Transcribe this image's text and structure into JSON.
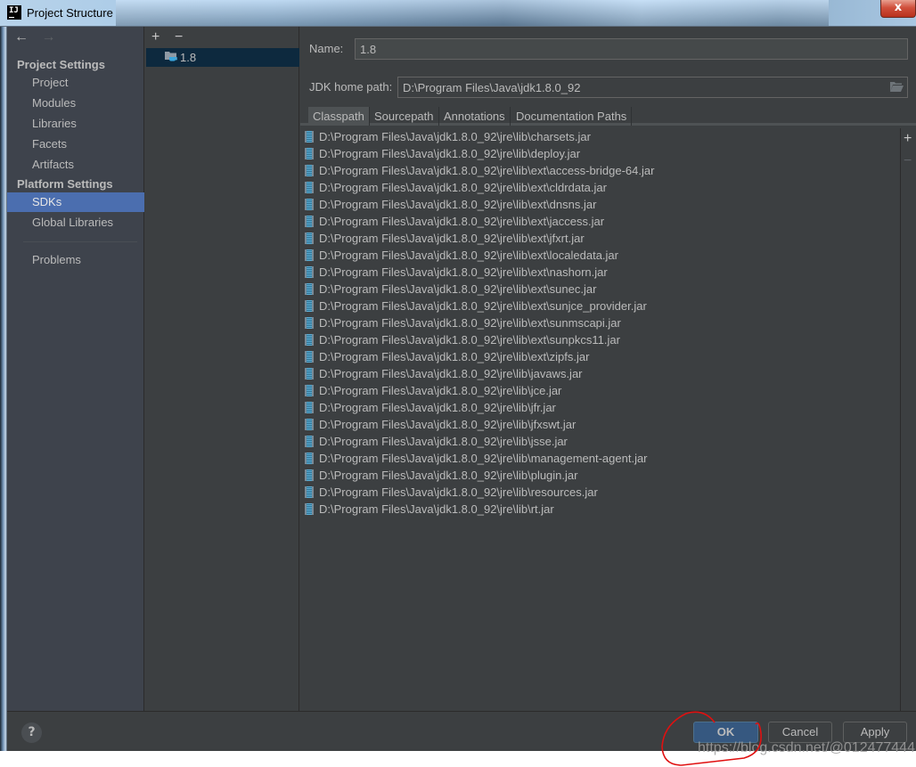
{
  "window": {
    "title": "Project Structure",
    "app_icon_text": "IJ",
    "close_label": "x"
  },
  "sidebar": {
    "back_icon": "←",
    "forward_icon": "→",
    "sections": [
      {
        "header": "Project Settings",
        "items": [
          {
            "label": "Project",
            "selected": false
          },
          {
            "label": "Modules",
            "selected": false
          },
          {
            "label": "Libraries",
            "selected": false
          },
          {
            "label": "Facets",
            "selected": false
          },
          {
            "label": "Artifacts",
            "selected": false
          }
        ]
      },
      {
        "header": "Platform Settings",
        "items": [
          {
            "label": "SDKs",
            "selected": true
          },
          {
            "label": "Global Libraries",
            "selected": false
          }
        ]
      }
    ],
    "extra_items": [
      {
        "label": "Problems"
      }
    ]
  },
  "sdk_list": {
    "add_icon": "+",
    "remove_icon": "−",
    "items": [
      {
        "label": "1.8",
        "selected": true
      }
    ]
  },
  "detail": {
    "name_label": "Name:",
    "name_value": "1.8",
    "jdk_home_label": "JDK home path:",
    "jdk_home_value": "D:\\Program Files\\Java\\jdk1.8.0_92",
    "tabs": [
      {
        "label": "Classpath",
        "active": true
      },
      {
        "label": "Sourcepath",
        "active": false
      },
      {
        "label": "Annotations",
        "active": false
      },
      {
        "label": "Documentation Paths",
        "active": false
      }
    ],
    "classpath": [
      "D:\\Program Files\\Java\\jdk1.8.0_92\\jre\\lib\\charsets.jar",
      "D:\\Program Files\\Java\\jdk1.8.0_92\\jre\\lib\\deploy.jar",
      "D:\\Program Files\\Java\\jdk1.8.0_92\\jre\\lib\\ext\\access-bridge-64.jar",
      "D:\\Program Files\\Java\\jdk1.8.0_92\\jre\\lib\\ext\\cldrdata.jar",
      "D:\\Program Files\\Java\\jdk1.8.0_92\\jre\\lib\\ext\\dnsns.jar",
      "D:\\Program Files\\Java\\jdk1.8.0_92\\jre\\lib\\ext\\jaccess.jar",
      "D:\\Program Files\\Java\\jdk1.8.0_92\\jre\\lib\\ext\\jfxrt.jar",
      "D:\\Program Files\\Java\\jdk1.8.0_92\\jre\\lib\\ext\\localedata.jar",
      "D:\\Program Files\\Java\\jdk1.8.0_92\\jre\\lib\\ext\\nashorn.jar",
      "D:\\Program Files\\Java\\jdk1.8.0_92\\jre\\lib\\ext\\sunec.jar",
      "D:\\Program Files\\Java\\jdk1.8.0_92\\jre\\lib\\ext\\sunjce_provider.jar",
      "D:\\Program Files\\Java\\jdk1.8.0_92\\jre\\lib\\ext\\sunmscapi.jar",
      "D:\\Program Files\\Java\\jdk1.8.0_92\\jre\\lib\\ext\\sunpkcs11.jar",
      "D:\\Program Files\\Java\\jdk1.8.0_92\\jre\\lib\\ext\\zipfs.jar",
      "D:\\Program Files\\Java\\jdk1.8.0_92\\jre\\lib\\javaws.jar",
      "D:\\Program Files\\Java\\jdk1.8.0_92\\jre\\lib\\jce.jar",
      "D:\\Program Files\\Java\\jdk1.8.0_92\\jre\\lib\\jfr.jar",
      "D:\\Program Files\\Java\\jdk1.8.0_92\\jre\\lib\\jfxswt.jar",
      "D:\\Program Files\\Java\\jdk1.8.0_92\\jre\\lib\\jsse.jar",
      "D:\\Program Files\\Java\\jdk1.8.0_92\\jre\\lib\\management-agent.jar",
      "D:\\Program Files\\Java\\jdk1.8.0_92\\jre\\lib\\plugin.jar",
      "D:\\Program Files\\Java\\jdk1.8.0_92\\jre\\lib\\resources.jar",
      "D:\\Program Files\\Java\\jdk1.8.0_92\\jre\\lib\\rt.jar"
    ],
    "add_path_icon": "+",
    "remove_path_icon": "−"
  },
  "footer": {
    "help_label": "?",
    "ok_label": "OK",
    "cancel_label": "Cancel",
    "apply_label": "Apply"
  },
  "overlay": {
    "watermark": "https://blog.csdn.net/@012477444",
    "annotation_color": "#e01010"
  },
  "colors": {
    "selection_blue": "#4b6eaf",
    "sdk_selected_bg": "#0d293e",
    "ok_button_bg": "#365880",
    "panel_bg": "#3c3f41",
    "text": "#bbbbbb"
  }
}
